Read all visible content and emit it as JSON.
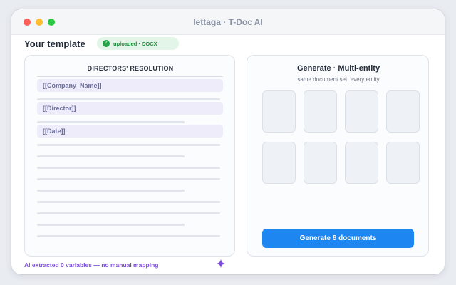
{
  "window": {
    "title": "lettaga · T-Doc AI"
  },
  "header": {
    "title": "Your template",
    "badge": "uploaded · DOCX",
    "badge_icon": "check-icon"
  },
  "template": {
    "doc_title": "DIRECTORS' RESOLUTION",
    "fields": [
      "[[Company_Name]]",
      "[[Director]]",
      "[[Date]]"
    ]
  },
  "generate": {
    "title": "Generate · Multi-entity",
    "subtitle": "same document set, every entity",
    "button_label": "Generate 8 documents",
    "document_count": 8
  },
  "footer": {
    "note": "AI extracted 0 variables — no manual mapping",
    "icon": "sparkle-icon"
  },
  "colors": {
    "accent": "#1d86f0",
    "ai": "#7c4ddc",
    "success": "#22a447",
    "field_bg": "#eeebfb"
  }
}
